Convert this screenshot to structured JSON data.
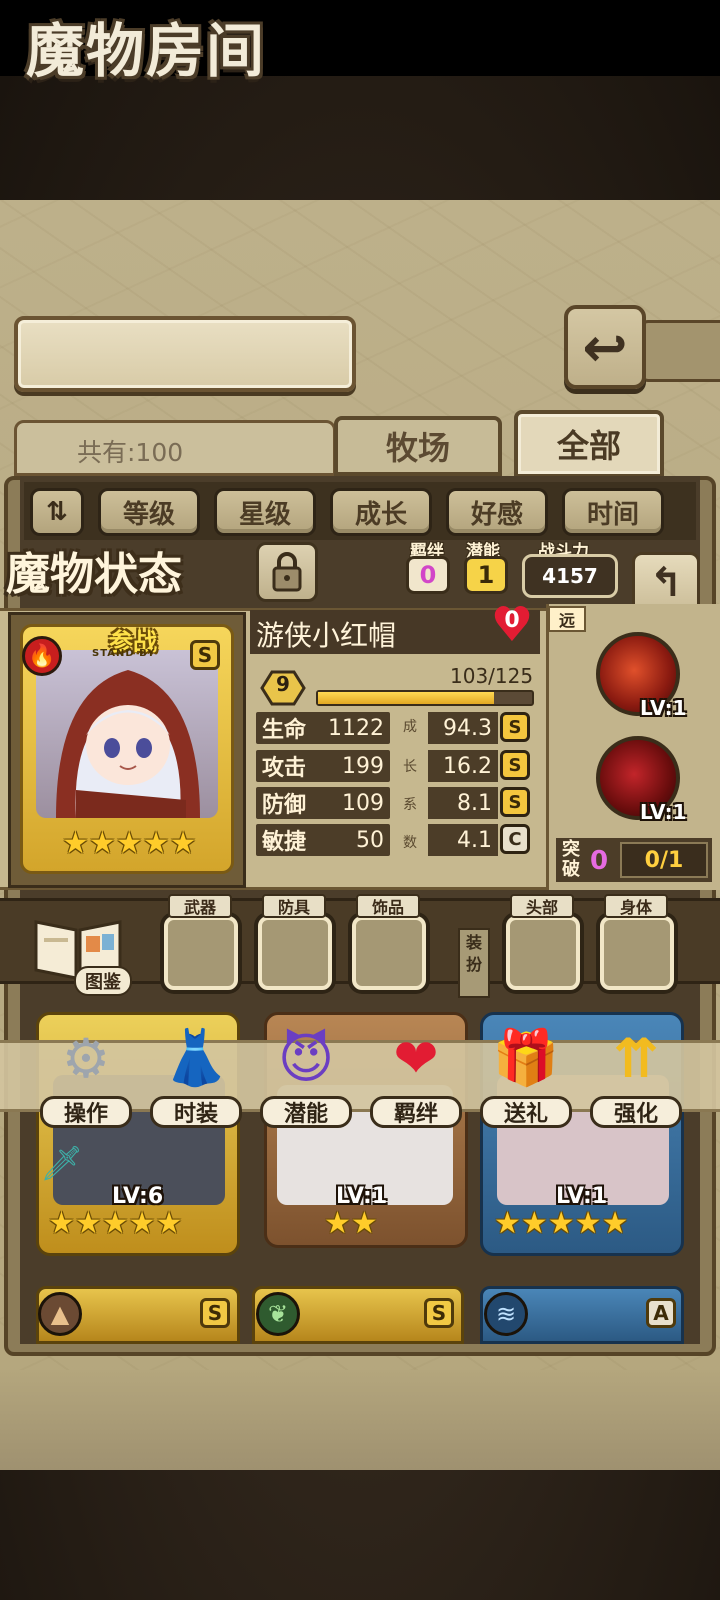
{
  "header": {
    "title": "魔物房间",
    "back_glyph": "↩"
  },
  "tabs": {
    "count_label": "共有:100",
    "ranch": "牧场",
    "all": "全部"
  },
  "sort": {
    "toggle_glyph": "⇅",
    "options": [
      "等级",
      "星级",
      "成长",
      "好感",
      "时间"
    ]
  },
  "status": {
    "title": "魔物状态",
    "bond_label": "羁绊",
    "bond_value": "0",
    "potential_label": "潜能",
    "potential_value": "1",
    "power_label": "战斗力",
    "power_value": "4157",
    "back_glyph": "↰"
  },
  "monster": {
    "standby_label": "参战",
    "standby_sub": "STAND BY",
    "rank": "S",
    "element_glyph": "🔥",
    "name": "游侠小红帽",
    "affection": "0",
    "level": "9",
    "exp_text": "103/125",
    "exp_fraction": 0.824,
    "stars": "★★★★★",
    "range_tag": "远",
    "stats": [
      {
        "label": "生命",
        "value": "1122",
        "growth": "94.3",
        "grade": "S"
      },
      {
        "label": "攻击",
        "value": "199",
        "growth": "16.2",
        "grade": "S"
      },
      {
        "label": "防御",
        "value": "109",
        "growth": "8.1",
        "grade": "S"
      },
      {
        "label": "敏捷",
        "value": "50",
        "growth": "4.1",
        "grade": "C"
      }
    ],
    "growth_vertical": [
      "成",
      "长",
      "系",
      "数"
    ],
    "skills": [
      {
        "icon": "arrow-skill-icon",
        "level": "LV:1"
      },
      {
        "icon": "blood-skill-icon",
        "level": "LV:1"
      }
    ],
    "breakthrough_label": "突破",
    "breakthrough_value": "0",
    "breakthrough_ratio": "0/1"
  },
  "equipment": {
    "codex_label": "图鉴",
    "dress_label": "装扮",
    "slots": [
      "武器",
      "防具",
      "饰品",
      "头部",
      "身体"
    ]
  },
  "actions": [
    {
      "label": "操作",
      "icon": "⚙"
    },
    {
      "label": "时装",
      "icon": "👗"
    },
    {
      "label": "潜能",
      "icon": "😈"
    },
    {
      "label": "羁绊",
      "icon": "❤"
    },
    {
      "label": "送礼",
      "icon": "🎁"
    },
    {
      "label": "强化",
      "icon": "⇈"
    }
  ],
  "roster": [
    {
      "level": "LV:6",
      "stars": "★★★★★"
    },
    {
      "level": "LV:1",
      "stars": "★★"
    },
    {
      "level": "LV:1",
      "stars": "★★★★★"
    }
  ],
  "roster_bottom": [
    {
      "rank": "S",
      "element": "▲"
    },
    {
      "rank": "S",
      "element": "❦"
    },
    {
      "rank": "A",
      "element": "≋"
    }
  ],
  "colors": {
    "accent_gold": "#f4c63e",
    "bond_pink": "#e66be1",
    "heart_red": "#e21c33"
  }
}
